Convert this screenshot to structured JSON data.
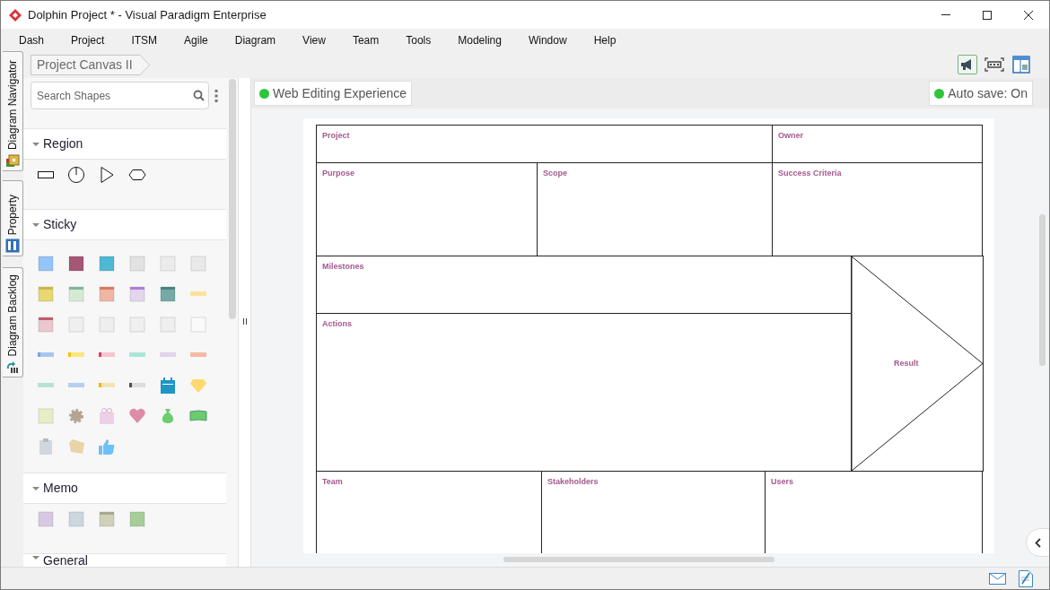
{
  "window": {
    "title": "Dolphin Project * - Visual Paradigm Enterprise"
  },
  "menu": [
    "Dash",
    "Project",
    "ITSM",
    "Agile",
    "Diagram",
    "View",
    "Team",
    "Tools",
    "Modeling",
    "Window",
    "Help"
  ],
  "side_tabs": [
    {
      "label": "Diagram Navigator"
    },
    {
      "label": "Property"
    },
    {
      "label": "Diagram Backlog"
    }
  ],
  "breadcrumb": "Project Canvas II",
  "palette": {
    "search": {
      "placeholder": "Search Shapes"
    },
    "sections": [
      {
        "title": "Region",
        "kind": "region",
        "expanded": true
      },
      {
        "title": "Sticky",
        "kind": "sticky",
        "expanded": true
      },
      {
        "title": "Memo",
        "kind": "memo",
        "expanded": true
      },
      {
        "title": "General",
        "kind": "general",
        "expanded": true
      }
    ]
  },
  "web_editing": {
    "label": "Web Editing Experience"
  },
  "auto_save": {
    "label": "Auto save: On"
  },
  "canvas": {
    "cells": [
      {
        "label": "Project"
      },
      {
        "label": "Owner"
      },
      {
        "label": "Purpose"
      },
      {
        "label": "Scope"
      },
      {
        "label": "Success Criteria"
      },
      {
        "label": "Milestones"
      },
      {
        "label": "Actions"
      },
      {
        "label": "Result",
        "kind": "arrow"
      },
      {
        "label": "Team"
      },
      {
        "label": "Stakeholders"
      },
      {
        "label": "Users"
      }
    ]
  }
}
